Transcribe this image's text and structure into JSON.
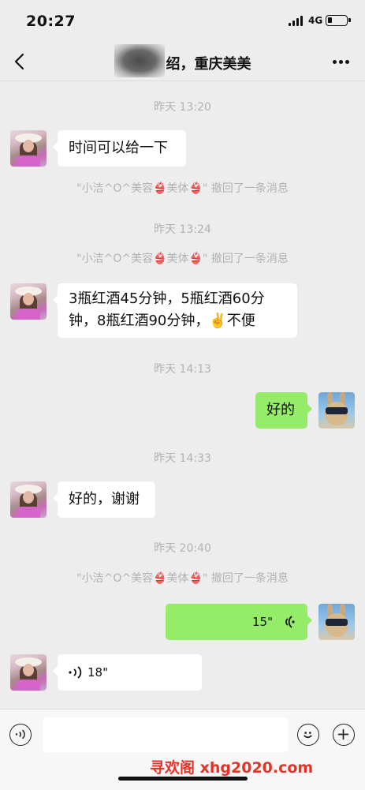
{
  "status_bar": {
    "time": "20:27",
    "network": "4G"
  },
  "header": {
    "title": "绍，重庆美美"
  },
  "messages": [
    {
      "type": "timestamp",
      "text": "昨天 13:20"
    },
    {
      "type": "text",
      "side": "left",
      "text": "时间可以给一下"
    },
    {
      "type": "system",
      "text": "\"小洁^O^美容👙美体👙\" 撤回了一条消息"
    },
    {
      "type": "timestamp",
      "text": "昨天 13:24"
    },
    {
      "type": "system",
      "text": "\"小洁^O^美容👙美体👙\" 撤回了一条消息"
    },
    {
      "type": "text",
      "side": "left",
      "line1": "3瓶红酒45分钟，5瓶红酒60分",
      "line2": "钟，8瓶红酒90分钟，✌️不便"
    },
    {
      "type": "timestamp",
      "text": "昨天 14:13"
    },
    {
      "type": "text",
      "side": "right",
      "text": "好的"
    },
    {
      "type": "timestamp",
      "text": "昨天 14:33"
    },
    {
      "type": "text",
      "side": "left",
      "text": "好的，谢谢"
    },
    {
      "type": "timestamp",
      "text": "昨天 20:40"
    },
    {
      "type": "system",
      "text": "\"小洁^O^美容👙美体👙\" 撤回了一条消息"
    },
    {
      "type": "voice",
      "side": "right",
      "duration": "15\""
    },
    {
      "type": "voice",
      "side": "left",
      "duration": "18\""
    }
  ],
  "watermark": "寻欢阁 xhg2020.com",
  "icons": {
    "back": "chevron-left-icon",
    "more": "more-dots-icon",
    "voice": "voice-icon",
    "emoji": "emoji-icon",
    "add": "plus-icon"
  }
}
